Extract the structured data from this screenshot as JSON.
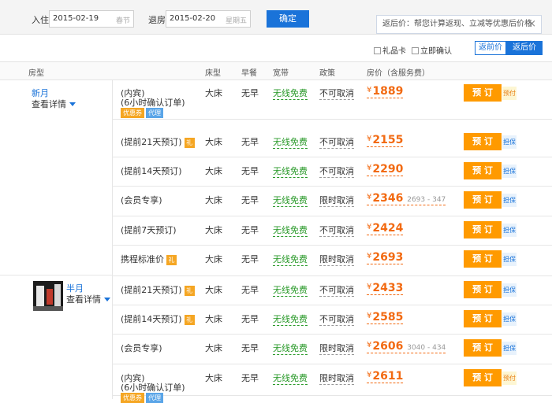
{
  "search": {
    "checkin_label": "入住",
    "checkin_date": "2015-02-19",
    "checkin_note": "春节",
    "checkout_label": "退房",
    "checkout_date": "2015-02-20",
    "checkout_note": "星期五",
    "confirm_label": "确定"
  },
  "tooltip": {
    "text": "返后价：帮您计算返现、立减等优惠后价格",
    "close": "×"
  },
  "filters": {
    "gift_card": "礼品卡",
    "instant_confirm": "立即确认",
    "before_label": "返前价",
    "after_label": "返后价"
  },
  "columns": [
    "房型",
    "床型",
    "早餐",
    "宽带",
    "政策",
    "房价（含服务费）"
  ],
  "groups": [
    {
      "name": "新月",
      "detail": "查看详情"
    },
    {
      "name": "半月",
      "detail": "查看详情"
    }
  ],
  "rows": [
    {
      "name": "(内宾)",
      "sub": "(6小时确认订单)",
      "tags": [
        "优惠券",
        "代理"
      ],
      "gift": "",
      "bed": "大床",
      "breakfast": "无早",
      "wifi": "无线免费",
      "policy": "不可取消",
      "price": "2611",
      "range": "",
      "book": "预 订",
      "side": "预付"
    }
  ],
  "list": [
    {
      "name": "(内宾)",
      "sub": "(6小时确认订单)",
      "tags": [
        "优惠券",
        "代理"
      ],
      "gift": "",
      "bed": "大床",
      "breakfast": "无早",
      "wifi": "无线免费",
      "policy": "不可取消",
      "price": "1889",
      "range": "",
      "book": "预 订",
      "side": "预付"
    },
    {
      "name": "(提前21天预订)",
      "sub": "",
      "tags": [],
      "gift": "礼",
      "bed": "大床",
      "breakfast": "无早",
      "wifi": "无线免费",
      "policy": "不可取消",
      "price": "2155",
      "range": "",
      "book": "预 订",
      "side": "担保"
    },
    {
      "name": "(提前14天预订)",
      "sub": "",
      "tags": [],
      "gift": "",
      "bed": "大床",
      "breakfast": "无早",
      "wifi": "无线免费",
      "policy": "不可取消",
      "price": "2290",
      "range": "",
      "book": "预 订",
      "side": "担保"
    },
    {
      "name": "(会员专享)",
      "sub": "",
      "tags": [],
      "gift": "",
      "bed": "大床",
      "breakfast": "无早",
      "wifi": "无线免费",
      "policy": "限时取消",
      "price": "2346",
      "range": "2693 - 347",
      "book": "预 订",
      "side": "担保"
    },
    {
      "name": "(提前7天预订)",
      "sub": "",
      "tags": [],
      "gift": "",
      "bed": "大床",
      "breakfast": "无早",
      "wifi": "无线免费",
      "policy": "不可取消",
      "price": "2424",
      "range": "",
      "book": "预 订",
      "side": "担保"
    },
    {
      "name": "携程标准价",
      "sub": "",
      "tags": [],
      "gift": "礼",
      "bed": "大床",
      "breakfast": "无早",
      "wifi": "无线免费",
      "policy": "限时取消",
      "price": "2693",
      "range": "",
      "book": "预 订",
      "side": "担保"
    },
    {
      "name": "(提前21天预订)",
      "sub": "",
      "tags": [],
      "gift": "礼",
      "bed": "大床",
      "breakfast": "无早",
      "wifi": "无线免费",
      "policy": "不可取消",
      "price": "2433",
      "range": "",
      "book": "预 订",
      "side": "担保"
    },
    {
      "name": "(提前14天预订)",
      "sub": "",
      "tags": [],
      "gift": "礼",
      "bed": "大床",
      "breakfast": "无早",
      "wifi": "无线免费",
      "policy": "不可取消",
      "price": "2585",
      "range": "",
      "book": "预 订",
      "side": "担保"
    },
    {
      "name": "(会员专享)",
      "sub": "",
      "tags": [],
      "gift": "",
      "bed": "大床",
      "breakfast": "无早",
      "wifi": "无线免费",
      "policy": "限时取消",
      "price": "2606",
      "range": "3040 - 434",
      "book": "预 订",
      "side": "担保"
    },
    {
      "name": "(内宾)",
      "sub": "(6小时确认订单)",
      "tags": [
        "优惠券",
        "代理"
      ],
      "gift": "",
      "bed": "大床",
      "breakfast": "无早",
      "wifi": "无线免费",
      "policy": "限时取消",
      "price": "2611",
      "range": "",
      "book": "预 订",
      "side": "预付"
    }
  ]
}
